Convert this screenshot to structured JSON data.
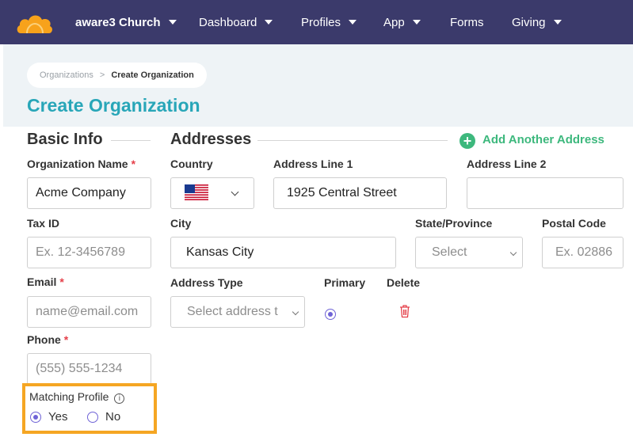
{
  "nav": {
    "logo_icon": "cloud-logo-icon",
    "brand": "aware3 Church",
    "items": [
      "Dashboard",
      "Profiles",
      "App",
      "Forms",
      "Giving"
    ]
  },
  "breadcrumb": {
    "parent": "Organizations",
    "separator": ">",
    "current": "Create Organization"
  },
  "page_title": "Create Organization",
  "basic_info": {
    "title": "Basic Info",
    "org_name": {
      "label": "Organization Name",
      "required": "*",
      "value": "Acme Company"
    },
    "tax_id": {
      "label": "Tax ID",
      "placeholder": "Ex. 12-3456789"
    },
    "email": {
      "label": "Email",
      "required": "*",
      "placeholder": "name@email.com"
    },
    "phone": {
      "label": "Phone",
      "required": "*",
      "placeholder": "(555) 555-1234"
    },
    "matching_profile": {
      "label": "Matching Profile",
      "info_icon": "i",
      "options": [
        {
          "label": "Yes",
          "selected": true
        },
        {
          "label": "No",
          "selected": false
        }
      ]
    }
  },
  "addresses": {
    "title": "Addresses",
    "add_label": "Add Another Address",
    "add_icon": "+",
    "country": {
      "label": "Country",
      "flag": "us-flag-icon"
    },
    "line1": {
      "label": "Address Line 1",
      "value": "1925 Central Street"
    },
    "line2": {
      "label": "Address Line 2",
      "value": ""
    },
    "city": {
      "label": "City",
      "value": "Kansas City"
    },
    "state": {
      "label": "State/Province",
      "value": "Select"
    },
    "postal": {
      "label": "Postal Code",
      "placeholder": "Ex. 02886"
    },
    "address_type": {
      "label": "Address Type",
      "value": "Select address t"
    },
    "primary": {
      "label": "Primary",
      "selected": true
    },
    "delete": {
      "label": "Delete"
    }
  },
  "colors": {
    "nav_bg": "#3b3a6b",
    "title": "#28a6b8",
    "accent_green": "#3db87d",
    "radio": "#6f63d6",
    "required": "#e5404a",
    "highlight": "#f5a623",
    "delete": "#e5404a"
  }
}
